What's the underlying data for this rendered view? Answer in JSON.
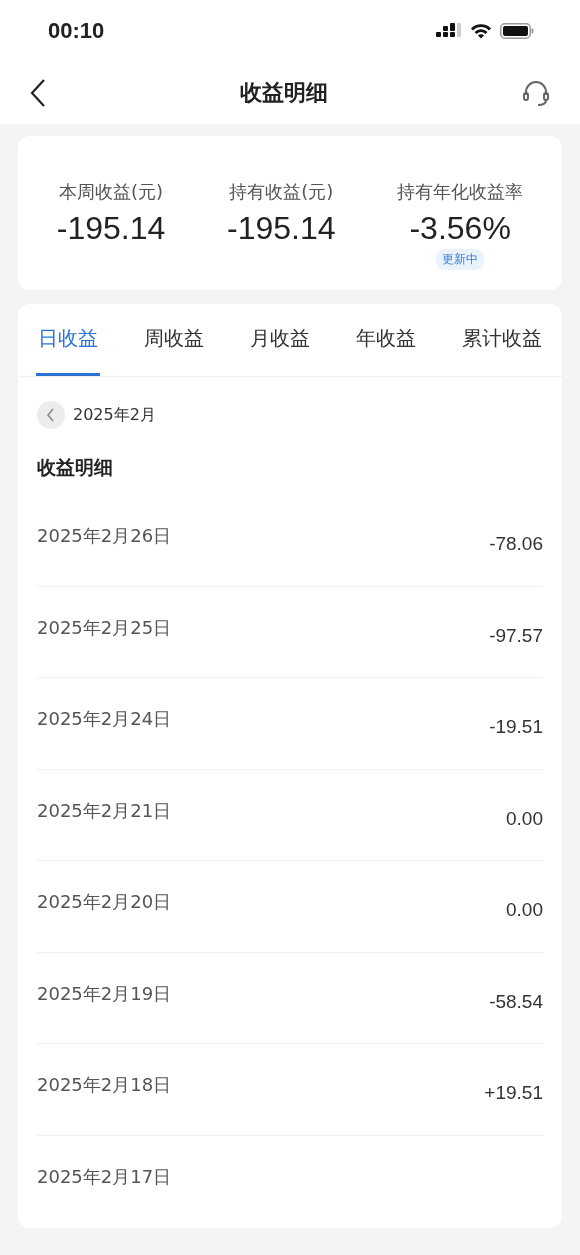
{
  "status_bar": {
    "time": "00:10"
  },
  "nav": {
    "title": "收益明细"
  },
  "summary": [
    {
      "label": "本周收益(元)",
      "value": "-195.14"
    },
    {
      "label": "持有收益(元)",
      "value": "-195.14"
    },
    {
      "label": "持有年化收益率",
      "value": "-3.56%",
      "badge": "更新中"
    }
  ],
  "tabs": [
    {
      "label": "日收益",
      "selected": true
    },
    {
      "label": "周收益",
      "selected": false
    },
    {
      "label": "月收益",
      "selected": false
    },
    {
      "label": "年收益",
      "selected": false
    },
    {
      "label": "累计收益",
      "selected": false
    }
  ],
  "month": "2025年2月",
  "section_title": "收益明细",
  "rows": [
    {
      "date": "2025年2月26日",
      "value": "-78.06"
    },
    {
      "date": "2025年2月25日",
      "value": "-97.57"
    },
    {
      "date": "2025年2月24日",
      "value": "-19.51"
    },
    {
      "date": "2025年2月21日",
      "value": "0.00"
    },
    {
      "date": "2025年2月20日",
      "value": "0.00"
    },
    {
      "date": "2025年2月19日",
      "value": "-58.54"
    },
    {
      "date": "2025年2月18日",
      "value": "+19.51"
    },
    {
      "date": "2025年2月17日"
    }
  ]
}
